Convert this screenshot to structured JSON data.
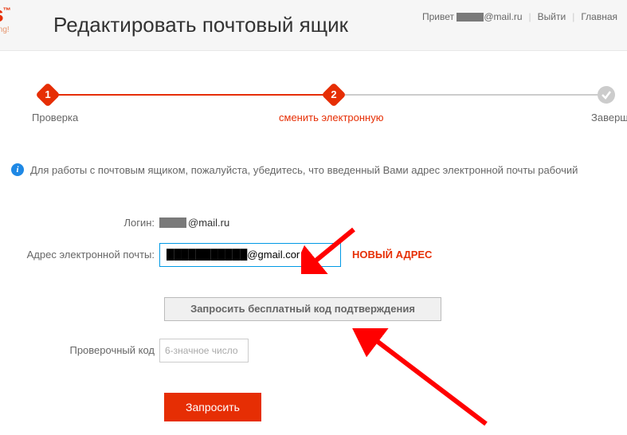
{
  "header": {
    "logo_fragment": "ess",
    "logo_tm": "™",
    "logo_sub": "etter Living!",
    "title": "Редактировать почтовый ящик",
    "greeting": "Привет",
    "email_suffix": "@mail.ru",
    "logout": "Выйти",
    "home": "Главная"
  },
  "steps": {
    "s1_num": "1",
    "s1_label": "Проверка",
    "s2_num": "2",
    "s2_label": "сменить электронную",
    "s3_label": "Завершить"
  },
  "info_text": "Для работы с почтовым ящиком, пожалуйста, убедитесь, что введенный Вами адрес электронной почты рабочий",
  "form": {
    "login_label": "Логин:",
    "login_suffix": "@mail.ru",
    "email_label": "Адрес электронной почты:",
    "email_value": "███████████@gmail.cor",
    "new_addr_annotation": "НОВЫЙ АДРЕС",
    "request_code_label": "Запросить бесплатный код подтверждения",
    "code_label": "Проверочный код",
    "code_placeholder": "6-значное число",
    "submit_label": "Запросить"
  }
}
